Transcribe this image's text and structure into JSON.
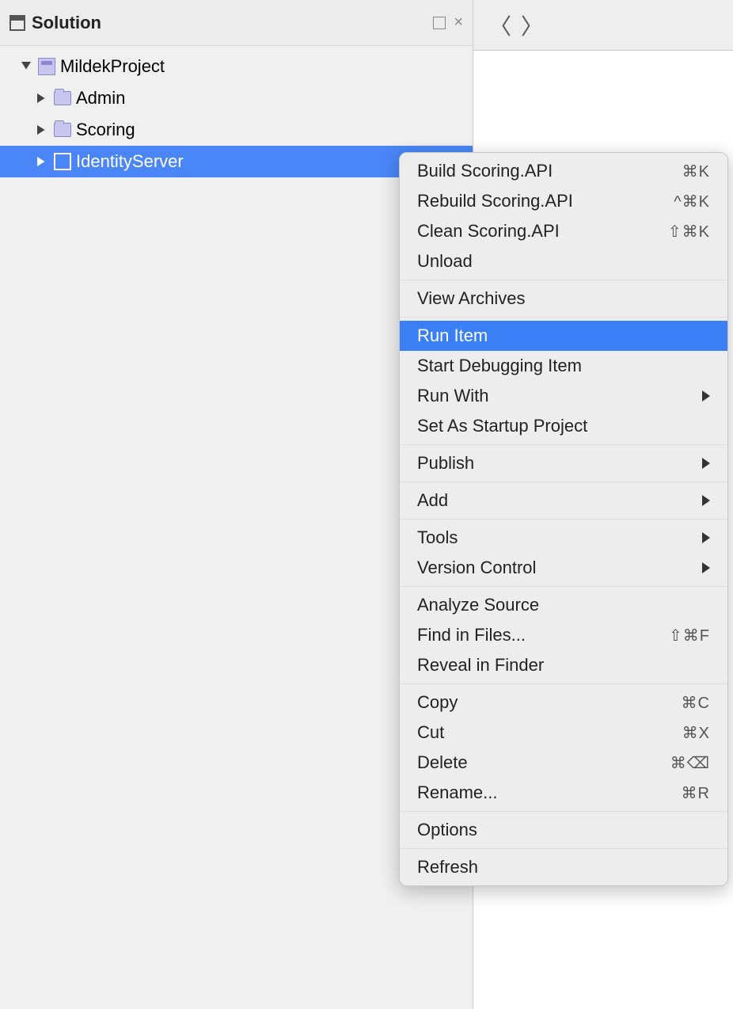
{
  "sidebar": {
    "title": "Solution",
    "tree": {
      "root": "MildekProject",
      "items": [
        {
          "label": "Admin"
        },
        {
          "label": "Scoring"
        },
        {
          "label": "IdentityServer"
        }
      ]
    }
  },
  "context_menu": {
    "groups": [
      [
        {
          "label": "Build Scoring.API",
          "shortcut": "⌘K"
        },
        {
          "label": "Rebuild Scoring.API",
          "shortcut": "^⌘K"
        },
        {
          "label": "Clean Scoring.API",
          "shortcut": "⇧⌘K"
        },
        {
          "label": "Unload"
        }
      ],
      [
        {
          "label": "View Archives"
        }
      ],
      [
        {
          "label": "Run Item",
          "highlight": true
        },
        {
          "label": "Start Debugging Item"
        },
        {
          "label": "Run With",
          "submenu": true
        },
        {
          "label": "Set As Startup Project"
        }
      ],
      [
        {
          "label": "Publish",
          "submenu": true
        }
      ],
      [
        {
          "label": "Add",
          "submenu": true
        }
      ],
      [
        {
          "label": "Tools",
          "submenu": true
        },
        {
          "label": "Version Control",
          "submenu": true
        }
      ],
      [
        {
          "label": "Analyze Source"
        },
        {
          "label": "Find in Files...",
          "shortcut": "⇧⌘F"
        },
        {
          "label": "Reveal in Finder"
        }
      ],
      [
        {
          "label": "Copy",
          "shortcut": "⌘C"
        },
        {
          "label": "Cut",
          "shortcut": "⌘X"
        },
        {
          "label": "Delete",
          "shortcut": "⌘⌫"
        },
        {
          "label": "Rename...",
          "shortcut": "⌘R"
        }
      ],
      [
        {
          "label": "Options"
        }
      ],
      [
        {
          "label": "Refresh"
        }
      ]
    ]
  }
}
